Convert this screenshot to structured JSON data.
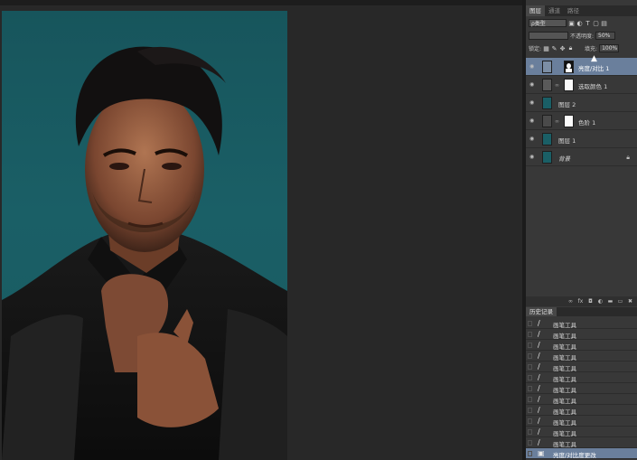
{
  "panel": {
    "tabs": [
      "图层",
      "通道",
      "路径"
    ],
    "filter": {
      "kind_label": "ρ类型"
    },
    "blend": {
      "label": "不透明度:",
      "value": "50%"
    },
    "lock": {
      "label": "锁定:",
      "fill_label": "填充:",
      "fill_value": "100%"
    },
    "layers": [
      {
        "name": "亮度/对比 1",
        "type": "adjustment",
        "active": true
      },
      {
        "name": "选取颜色 1",
        "type": "adjustment",
        "active": false
      },
      {
        "name": "图层 2",
        "type": "image",
        "active": false
      },
      {
        "name": "色阶 1",
        "type": "adjustment",
        "active": false
      },
      {
        "name": "图层 1",
        "type": "image",
        "active": false
      },
      {
        "name": "背景",
        "type": "background",
        "active": false
      }
    ]
  },
  "history": {
    "tab_label": "历史记录",
    "items": [
      "画笔工具",
      "画笔工具",
      "画笔工具",
      "画笔工具",
      "画笔工具",
      "画笔工具",
      "画笔工具",
      "画笔工具",
      "画笔工具",
      "画笔工具",
      "画笔工具",
      "画笔工具"
    ],
    "current_item": "亮度/对比度更改"
  },
  "icons": {
    "visibility": "eye-icon",
    "lock": "lock-icon",
    "brush": "brush-icon"
  },
  "colors": {
    "photo_background": "#1a5f66",
    "selection": "#6a7f9c"
  }
}
